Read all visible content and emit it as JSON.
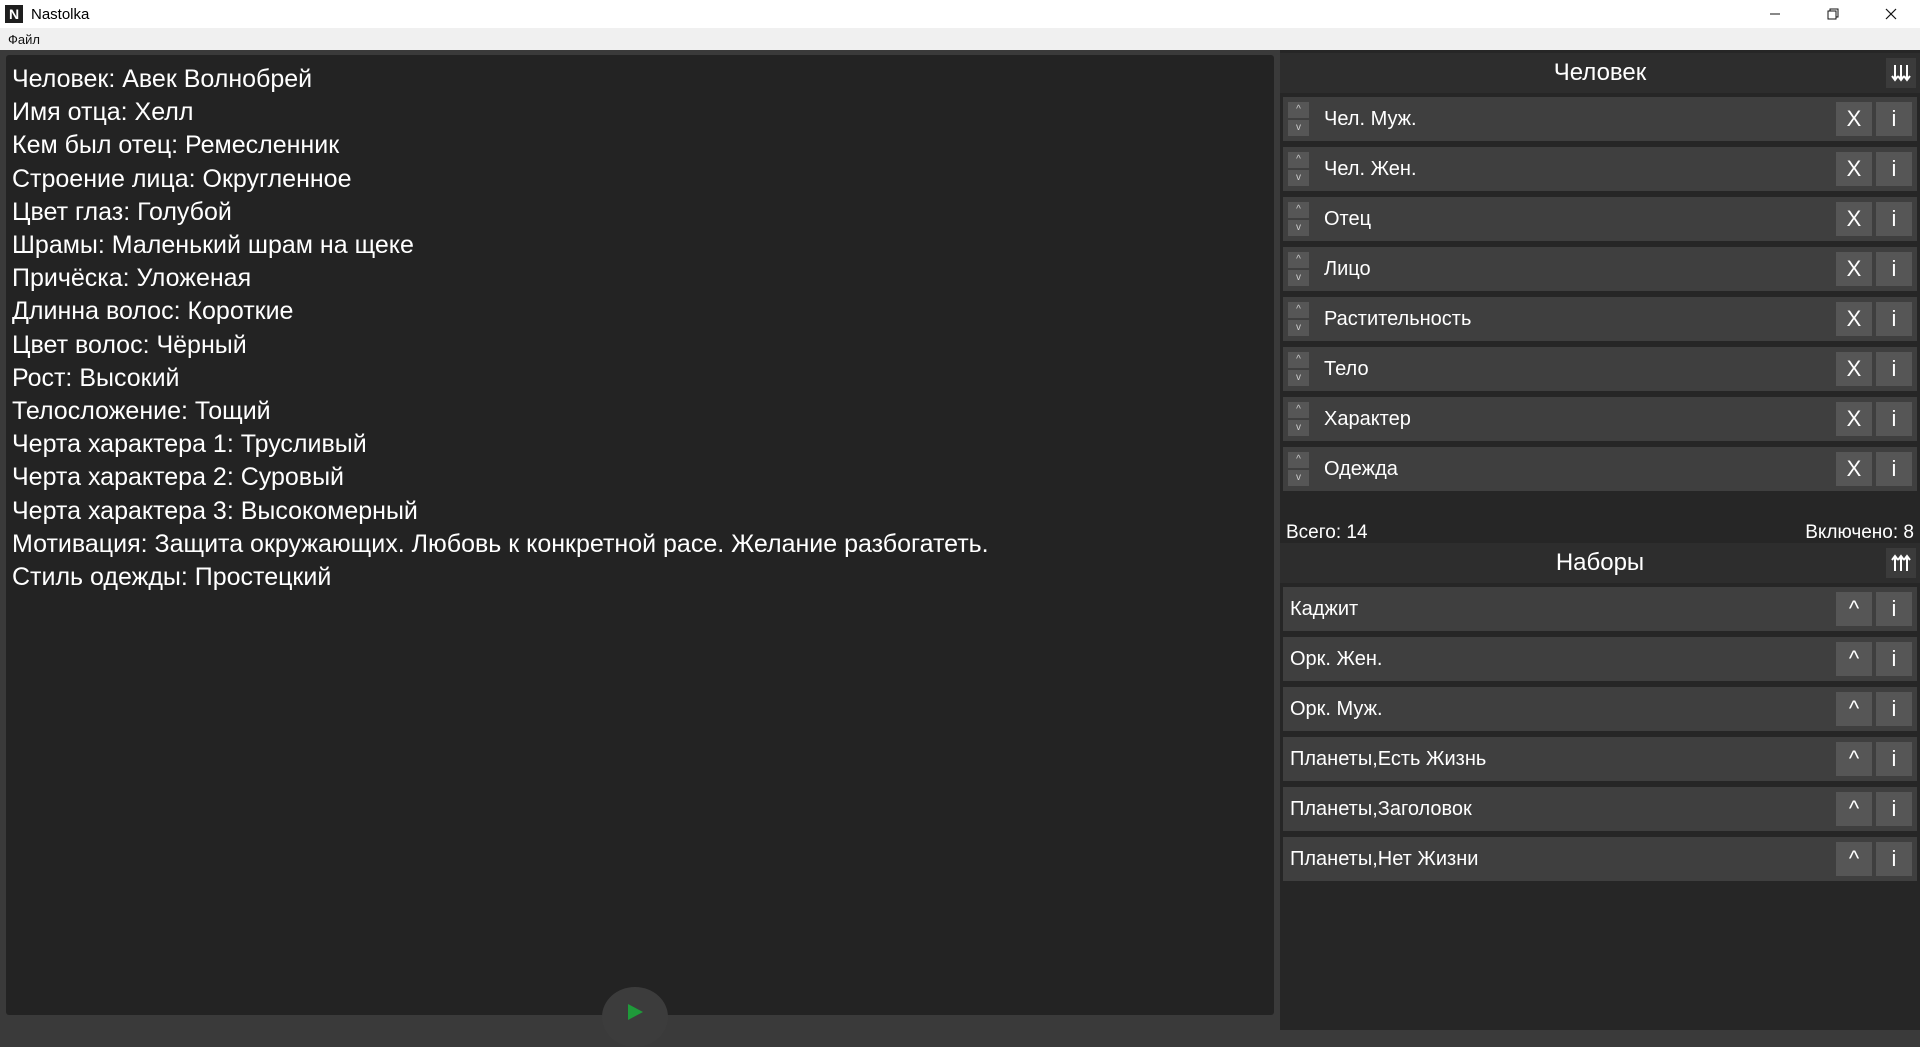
{
  "window": {
    "app_icon": "N",
    "title": "Nastolka",
    "minimize_icon": "minimize-icon",
    "maximize_icon": "restore-icon",
    "close_icon": "close-icon"
  },
  "menu": {
    "items": [
      "Файл"
    ]
  },
  "output": {
    "lines": [
      "Человек: Авек Волнобрей",
      "Имя отца: Хелл",
      "Кем был отец: Ремесленник",
      "Строение лица: Округленное",
      "Цвет глаз: Голубой",
      "Шрамы: Маленький шрам на щеке",
      "Причёска: Уложеная",
      "Длинна волос: Короткие",
      "Цвет волос: Чёрный",
      "Рост: Высокий",
      "Телосложение: Тощий",
      "Черта характера 1: Трусливый",
      "Черта характера 2: Суровый",
      "Черта характера 3: Высокомерный",
      "Мотивация: Защита окружающих. Любовь к конкретной расе. Желание разбогатеть.",
      "Стиль одежды: Простецкий"
    ],
    "generate_icon": "play-icon",
    "generate_color": "#1f9a3a"
  },
  "generators": {
    "title": "Человек",
    "sort_icon": "sort-icon",
    "up_glyph": "^",
    "down_glyph": "v",
    "remove_glyph": "X",
    "info_glyph": "i",
    "items": [
      {
        "label": "Чел. Муж."
      },
      {
        "label": "Чел. Жен."
      },
      {
        "label": "Отец"
      },
      {
        "label": "Лицо"
      },
      {
        "label": "Растительность"
      },
      {
        "label": "Тело"
      },
      {
        "label": "Характер"
      },
      {
        "label": "Одежда"
      }
    ]
  },
  "stats": {
    "total": "Всего: 14",
    "enabled": "Включено: 8"
  },
  "sets": {
    "title": "Наборы",
    "sort_icon": "sort-icon",
    "add_glyph": "^",
    "info_glyph": "i",
    "items": [
      {
        "label": "Каджит"
      },
      {
        "label": "Орк. Жен."
      },
      {
        "label": "Орк. Муж."
      },
      {
        "label": "Планеты,Есть Жизнь"
      },
      {
        "label": "Планеты,Заголовок"
      },
      {
        "label": "Планеты,Нет Жизни"
      }
    ]
  },
  "colors": {
    "panel_bg": "#232323",
    "row_bg": "#3f3f3f",
    "button_bg": "#565656",
    "text": "#ffffff"
  }
}
